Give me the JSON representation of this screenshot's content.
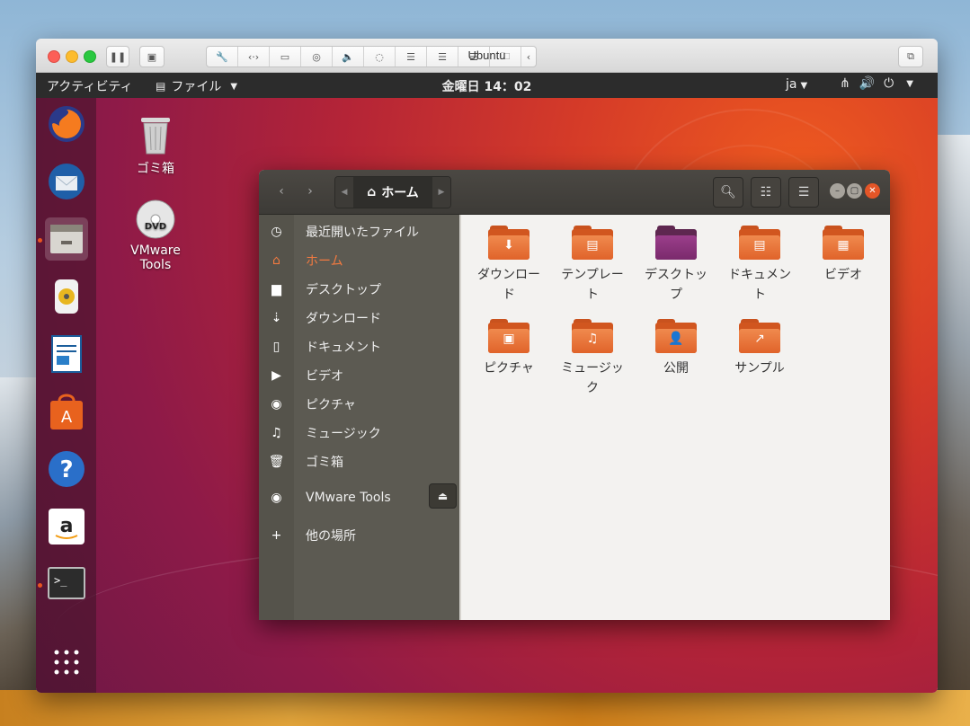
{
  "vm": {
    "title": "Ubuntu",
    "toolbar_icons": [
      "pause-icon",
      "snapshot-icon",
      "wrench-icon",
      "code-icon",
      "drive-icon",
      "camera-icon",
      "sound-icon",
      "mouse-icon",
      "disk-icon",
      "disk-icon",
      "disk-icon",
      "folder-icon",
      "chevron-left-icon",
      "window-icon"
    ]
  },
  "topbar": {
    "activities": "アクティビティ",
    "app_menu": "ファイル",
    "clock": "金曜日 14：02",
    "lang": "ja"
  },
  "desktop": {
    "trash_label": "ゴミ箱",
    "vmware_label_1": "VMware",
    "vmware_label_2": "Tools"
  },
  "dock": {
    "items": [
      "firefox-icon",
      "thunderbird-icon",
      "files-icon",
      "rhythmbox-icon",
      "writer-icon",
      "software-icon",
      "help-icon",
      "amazon-icon",
      "terminal-icon",
      "show-apps-icon"
    ]
  },
  "files": {
    "path_label": "ホーム",
    "sidebar": [
      {
        "icon": "◷",
        "label": "最近開いたファイル"
      },
      {
        "icon": "⌂",
        "label": "ホーム"
      },
      {
        "icon": "▆",
        "label": "デスクトップ"
      },
      {
        "icon": "⇣",
        "label": "ダウンロード"
      },
      {
        "icon": "▯",
        "label": "ドキュメント"
      },
      {
        "icon": "▶",
        "label": "ビデオ"
      },
      {
        "icon": "◉",
        "label": "ピクチャ"
      },
      {
        "icon": "♫",
        "label": "ミュージック"
      },
      {
        "icon": "🗑",
        "label": "ゴミ箱"
      }
    ],
    "mount_label": "VMware Tools",
    "other_places": "他の場所",
    "folders": [
      {
        "line1": "ダウンロー",
        "line2": "ド",
        "emblem": "⬇"
      },
      {
        "line1": "テンプレー",
        "line2": "ト",
        "emblem": "▤"
      },
      {
        "line1": "デスクトッ",
        "line2": "プ",
        "emblem": ""
      },
      {
        "line1": "ドキュメン",
        "line2": "ト",
        "emblem": "▤"
      },
      {
        "line1": "ビデオ",
        "line2": "",
        "emblem": "▦"
      },
      {
        "line1": "ピクチャ",
        "line2": "",
        "emblem": "▣"
      },
      {
        "line1": "ミュージッ",
        "line2": "ク",
        "emblem": "♫"
      },
      {
        "line1": "公開",
        "line2": "",
        "emblem": "👤"
      },
      {
        "line1": "サンプル",
        "line2": "",
        "emblem": "↗"
      }
    ]
  },
  "colors": {
    "accent": "#e95420",
    "headerbar": "#3d3b37",
    "sidebar": "#5c5a52"
  }
}
